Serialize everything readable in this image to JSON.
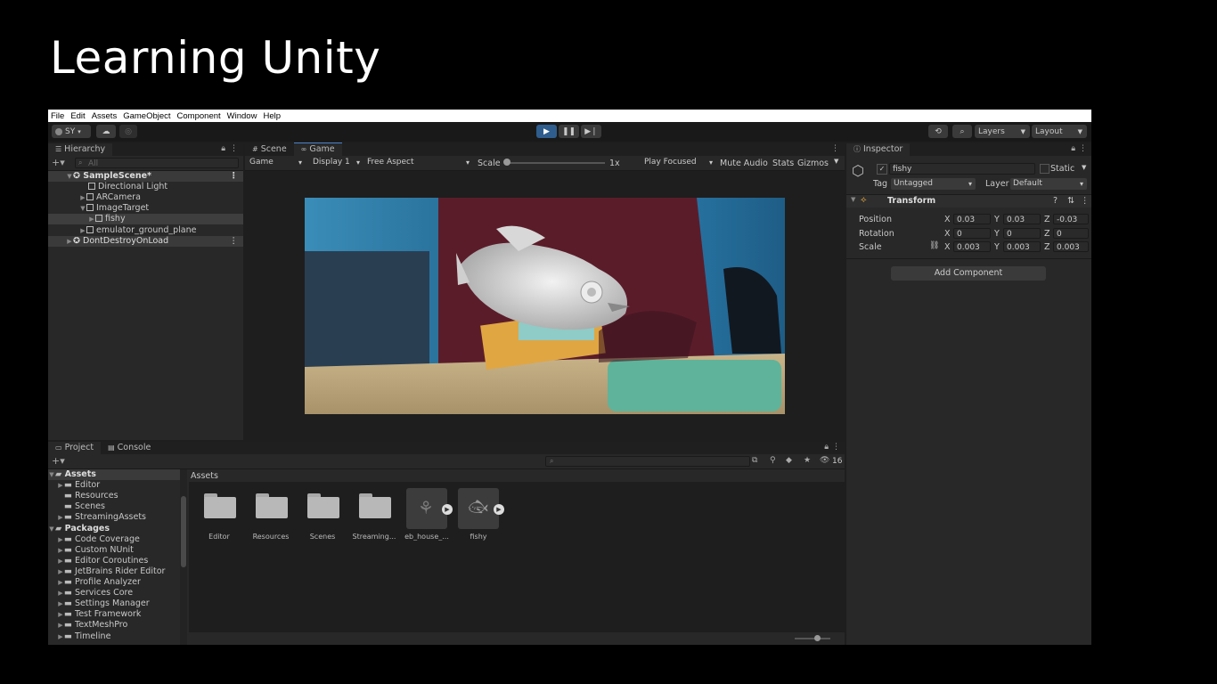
{
  "slide": {
    "title": "Learning Unity"
  },
  "menu": [
    "File",
    "Edit",
    "Assets",
    "GameObject",
    "Component",
    "Window",
    "Help"
  ],
  "toolbar": {
    "account": "SY",
    "layers": "Layers",
    "layout": "Layout"
  },
  "hierarchy": {
    "tab": "Hierarchy",
    "search_placeholder": "All",
    "items": [
      {
        "label": "SampleScene*"
      },
      {
        "label": "Directional Light"
      },
      {
        "label": "ARCamera"
      },
      {
        "label": "ImageTarget"
      },
      {
        "label": "fishy"
      },
      {
        "label": "emulator_ground_plane"
      },
      {
        "label": "DontDestroyOnLoad"
      }
    ]
  },
  "game": {
    "tabs": [
      "Scene",
      "Game"
    ],
    "mode": "Game",
    "display": "Display 1",
    "aspect": "Free Aspect",
    "scale_label": "Scale",
    "scale_value": "1x",
    "play_focused": "Play Focused",
    "mute": "Mute Audio",
    "stats": "Stats",
    "gizmos": "Gizmos"
  },
  "inspector": {
    "tab": "Inspector",
    "object_name": "fishy",
    "static_label": "Static",
    "tag_label": "Tag",
    "tag_value": "Untagged",
    "layer_label": "Layer",
    "layer_value": "Default",
    "transform_title": "Transform",
    "position_label": "Position",
    "rotation_label": "Rotation",
    "scale_label": "Scale",
    "axis": {
      "x": "X",
      "y": "Y",
      "z": "Z"
    },
    "position": {
      "x": "0.03",
      "y": "0.03",
      "z": "-0.03"
    },
    "rotation": {
      "x": "0",
      "y": "0",
      "z": "0"
    },
    "scale": {
      "x": "0.003",
      "y": "0.003",
      "z": "0.003"
    },
    "add_component": "Add Component"
  },
  "project": {
    "tabs": [
      "Project",
      "Console"
    ],
    "hidden_count": "16",
    "breadcrumb": "Assets",
    "tree": [
      {
        "label": "Assets"
      },
      {
        "label": "Editor"
      },
      {
        "label": "Resources"
      },
      {
        "label": "Scenes"
      },
      {
        "label": "StreamingAssets"
      },
      {
        "label": "Packages"
      },
      {
        "label": "Code Coverage"
      },
      {
        "label": "Custom NUnit"
      },
      {
        "label": "Editor Coroutines"
      },
      {
        "label": "JetBrains Rider Editor"
      },
      {
        "label": "Profile Analyzer"
      },
      {
        "label": "Services Core"
      },
      {
        "label": "Settings Manager"
      },
      {
        "label": "Test Framework"
      },
      {
        "label": "TextMeshPro"
      },
      {
        "label": "Timeline"
      }
    ],
    "assets": [
      {
        "label": "Editor"
      },
      {
        "label": "Resources"
      },
      {
        "label": "Scenes"
      },
      {
        "label": "Streaming..."
      },
      {
        "label": "eb_house_..."
      },
      {
        "label": "fishy"
      }
    ]
  }
}
